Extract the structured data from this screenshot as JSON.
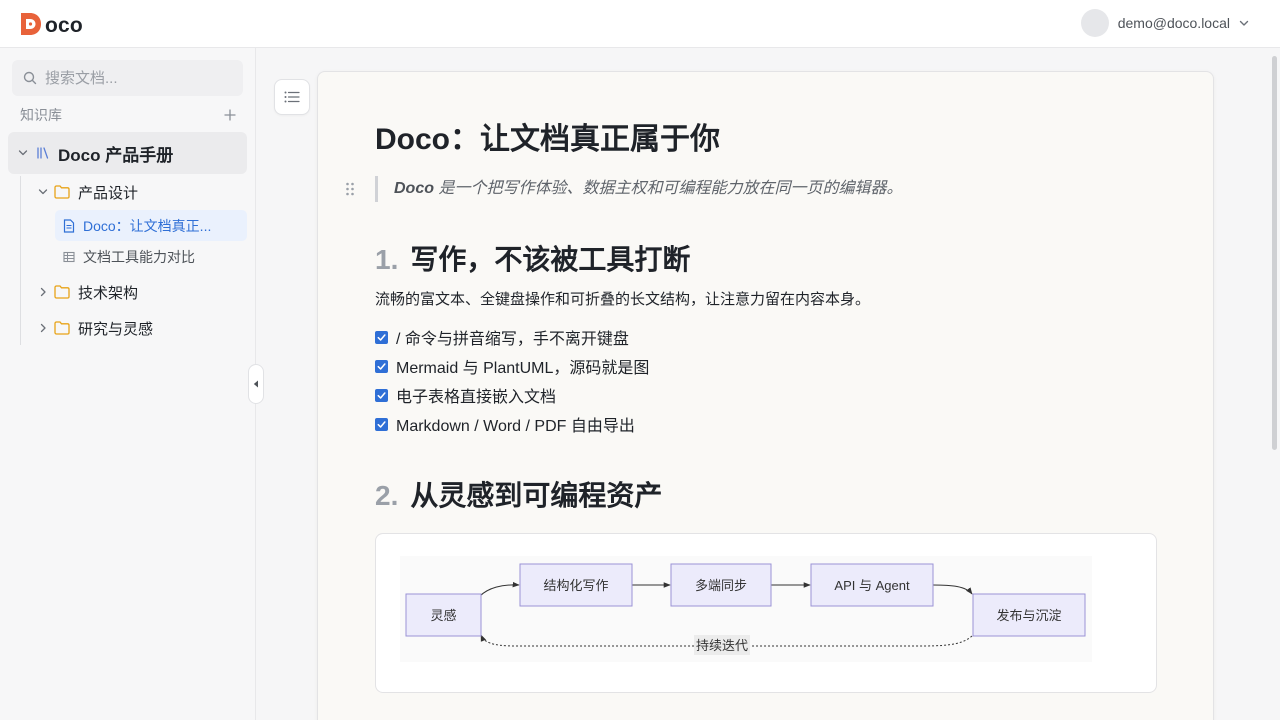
{
  "app": {
    "logo_text": "oco",
    "brand_color": "#e8623a"
  },
  "header": {
    "user_email": "demo@doco.local"
  },
  "sidebar": {
    "search_placeholder": "搜索文档...",
    "kb_title": "知识库",
    "root": {
      "label": "Doco 产品手册",
      "icon": "library-icon"
    },
    "items": [
      {
        "label": "产品设计",
        "icon": "folder-icon",
        "expanded": true
      },
      {
        "label": "Doco：让文档真正...",
        "icon": "document-icon",
        "active": true
      },
      {
        "label": "文档工具能力对比",
        "icon": "table-icon"
      },
      {
        "label": "技术架构",
        "icon": "folder-icon",
        "expanded": false
      },
      {
        "label": "研究与灵感",
        "icon": "folder-icon",
        "expanded": false
      }
    ]
  },
  "document": {
    "title": "Doco：让文档真正属于你",
    "quote_bold": "Doco",
    "quote_rest": " 是一个把写作体验、数据主权和可编程能力放在同一页的编辑器。",
    "sections": [
      {
        "number": "1.",
        "heading": "写作，不该被工具打断"
      },
      {
        "number": "2.",
        "heading": "从灵感到可编程资产"
      }
    ],
    "paragraph": "流畅的富文本、全键盘操作和可折叠的长文结构，让注意力留在内容本身。",
    "tasks": [
      {
        "text": "/ 命令与拼音缩写，手不离开键盘",
        "checked": true
      },
      {
        "text": "Mermaid 与 PlantUML，源码就是图",
        "checked": true
      },
      {
        "text": "电子表格直接嵌入文档",
        "checked": true
      },
      {
        "text": "Markdown / Word / PDF 自由导出",
        "checked": true
      }
    ],
    "diagram": {
      "nodes": [
        "灵感",
        "结构化写作",
        "多端同步",
        "API 与 Agent",
        "发布与沉淀"
      ],
      "loop_label": "持续迭代",
      "node_fill": "#ecebfb",
      "node_stroke": "#9b93d6"
    }
  }
}
